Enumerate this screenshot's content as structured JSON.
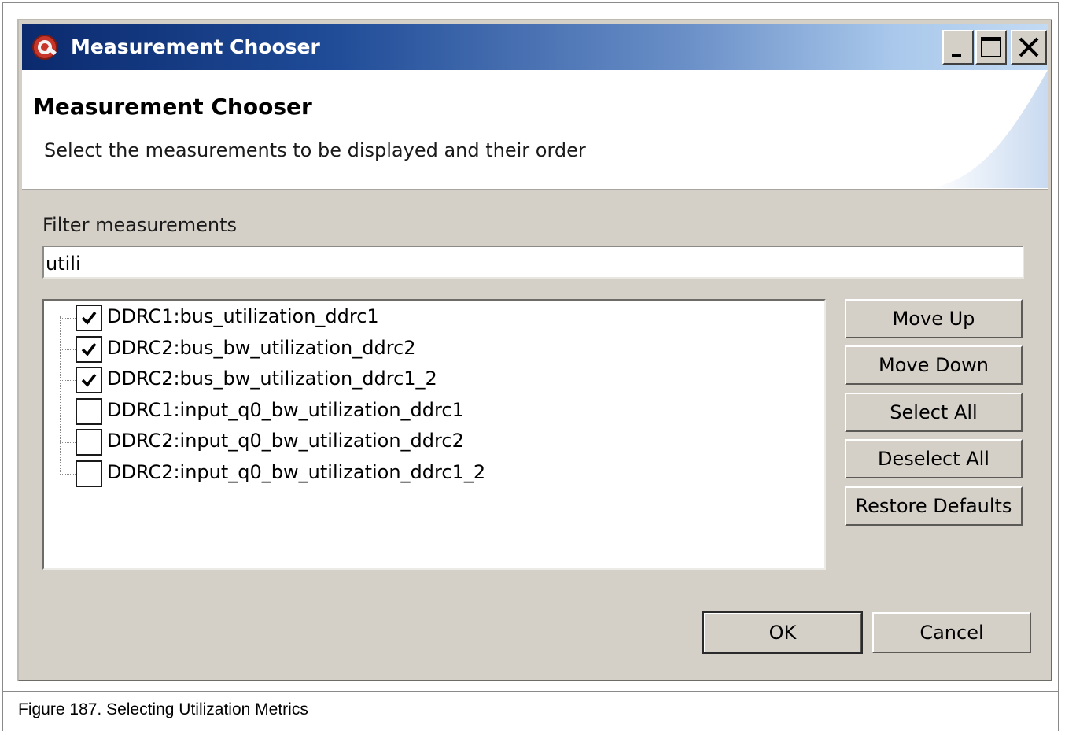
{
  "window": {
    "title": "Measurement Chooser",
    "icon": "app-logo-icon",
    "controls": [
      "minimize-icon",
      "maximize-icon",
      "close-icon"
    ]
  },
  "header": {
    "title": "Measurement Chooser",
    "description": "Select the measurements to be displayed and their order"
  },
  "filter": {
    "label": "Filter measurements",
    "value": "utili"
  },
  "measurements": [
    {
      "label": "DDRC1:bus_utilization_ddrc1",
      "checked": true
    },
    {
      "label": "DDRC2:bus_bw_utilization_ddrc2",
      "checked": true
    },
    {
      "label": "DDRC2:bus_bw_utilization_ddrc1_2",
      "checked": true
    },
    {
      "label": "DDRC1:input_q0_bw_utilization_ddrc1",
      "checked": false
    },
    {
      "label": "DDRC2:input_q0_bw_utilization_ddrc2",
      "checked": false
    },
    {
      "label": "DDRC2:input_q0_bw_utilization_ddrc1_2",
      "checked": false
    }
  ],
  "side_buttons": {
    "move_up": "Move Up",
    "move_down": "Move Down",
    "select_all": "Select All",
    "deselect_all": "Deselect All",
    "restore_defaults": "Restore Defaults"
  },
  "dialog_buttons": {
    "ok": "OK",
    "cancel": "Cancel"
  },
  "caption": "Figure 187.  Selecting Utilization Metrics",
  "colors": {
    "titlebar_start": "#0b2a6e",
    "titlebar_end": "#c3daf3",
    "dialog_bg": "#d4d0c8"
  }
}
